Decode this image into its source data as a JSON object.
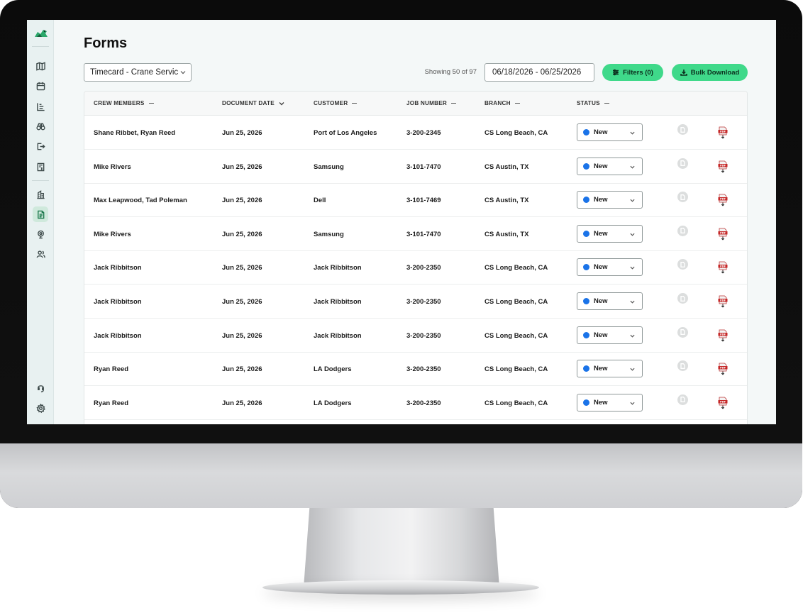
{
  "app": {
    "page_title": "Forms",
    "form_select_value": "Timecard - Crane Servic",
    "showing_text": "Showing 50 of 97",
    "date_range": "06/18/2026 - 06/25/2026",
    "filters_label": "Filters (0)",
    "bulk_download_label": "Bulk Download",
    "accent_color": "#3fd98a",
    "status_dot_color": "#1a73e8"
  },
  "sidebar": {
    "items": [
      {
        "icon": "map-icon"
      },
      {
        "icon": "calendar-icon"
      },
      {
        "icon": "chart-icon"
      },
      {
        "icon": "binoculars-icon"
      },
      {
        "icon": "logout-icon"
      },
      {
        "icon": "invoice-icon"
      },
      {
        "icon": "building-icon"
      },
      {
        "icon": "forms-icon",
        "active": true
      },
      {
        "icon": "location-icon"
      },
      {
        "icon": "users-icon"
      },
      {
        "icon": "support-icon"
      },
      {
        "icon": "settings-icon"
      }
    ]
  },
  "table": {
    "columns": {
      "crew": "CREW MEMBERS",
      "date": "DOCUMENT DATE",
      "customer": "CUSTOMER",
      "job": "JOB NUMBER",
      "branch": "BRANCH",
      "status": "STATUS"
    },
    "rows": [
      {
        "crew": "Shane Ribbet, Ryan Reed",
        "date": "Jun 25, 2026",
        "customer": "Port of Los Angeles",
        "job": "3-200-2345",
        "branch": "CS Long Beach, CA",
        "status": "New"
      },
      {
        "crew": "Mike Rivers",
        "date": "Jun 25, 2026",
        "customer": "Samsung",
        "job": "3-101-7470",
        "branch": "CS Austin, TX",
        "status": "New"
      },
      {
        "crew": "Max Leapwood, Tad Poleman",
        "date": "Jun 25, 2026",
        "customer": "Dell",
        "job": "3-101-7469",
        "branch": "CS Austin, TX",
        "status": "New"
      },
      {
        "crew": "Mike Rivers",
        "date": "Jun 25, 2026",
        "customer": "Samsung",
        "job": "3-101-7470",
        "branch": "CS Austin, TX",
        "status": "New"
      },
      {
        "crew": "Jack Ribbitson",
        "date": "Jun 25, 2026",
        "customer": "Jack Ribbitson",
        "job": "3-200-2350",
        "branch": "CS Long Beach, CA",
        "status": "New"
      },
      {
        "crew": "Jack Ribbitson",
        "date": "Jun 25, 2026",
        "customer": "Jack Ribbitson",
        "job": "3-200-2350",
        "branch": "CS Long Beach, CA",
        "status": "New"
      },
      {
        "crew": "Jack Ribbitson",
        "date": "Jun 25, 2026",
        "customer": "Jack Ribbitson",
        "job": "3-200-2350",
        "branch": "CS Long Beach, CA",
        "status": "New"
      },
      {
        "crew": "Ryan Reed",
        "date": "Jun 25, 2026",
        "customer": "LA Dodgers",
        "job": "3-200-2350",
        "branch": "CS Long Beach, CA",
        "status": "New"
      },
      {
        "crew": "Ryan Reed",
        "date": "Jun 25, 2026",
        "customer": "LA Dodgers",
        "job": "3-200-2350",
        "branch": "CS Long Beach, CA",
        "status": "New"
      }
    ]
  }
}
